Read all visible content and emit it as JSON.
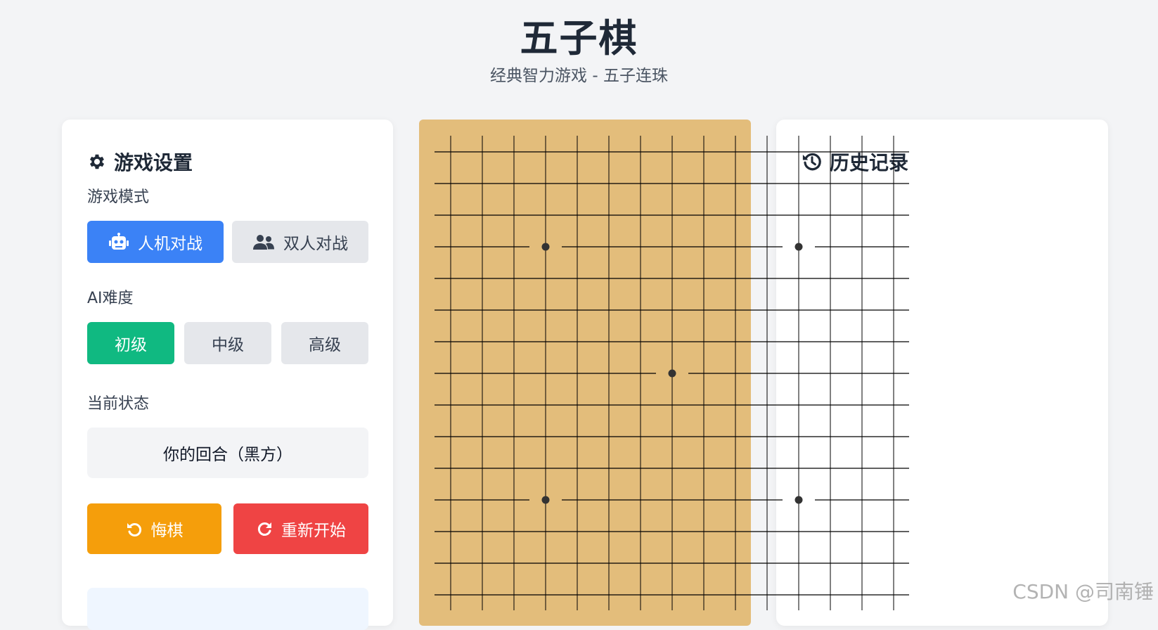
{
  "header": {
    "title": "五子棋",
    "subtitle": "经典智力游戏 - 五子连珠"
  },
  "settings": {
    "title": "游戏设置",
    "title_icon": "gear-icon",
    "mode_label": "游戏模式",
    "mode_buttons": [
      {
        "label": "人机对战",
        "icon": "robot-icon",
        "selected": true
      },
      {
        "label": "双人对战",
        "icon": "users-icon",
        "selected": false
      }
    ],
    "difficulty_label": "AI难度",
    "difficulty_buttons": [
      {
        "label": "初级",
        "selected": true
      },
      {
        "label": "中级",
        "selected": false
      },
      {
        "label": "高级",
        "selected": false
      }
    ],
    "status_label": "当前状态",
    "status_text": "你的回合（黑方）",
    "undo_label": "悔棋",
    "undo_icon": "undo-icon",
    "restart_label": "重新开始",
    "restart_icon": "restart-icon"
  },
  "history": {
    "title": "历史记录",
    "title_icon": "history-icon"
  },
  "board": {
    "background_color": "#e3bd7b",
    "line_color": "#000000",
    "star_point_color": "#333333"
  },
  "colors": {
    "primary": "#3b82f6",
    "success": "#10b981",
    "warning": "#f59e0b",
    "danger": "#ef4444"
  },
  "watermark": "CSDN @司南锤"
}
